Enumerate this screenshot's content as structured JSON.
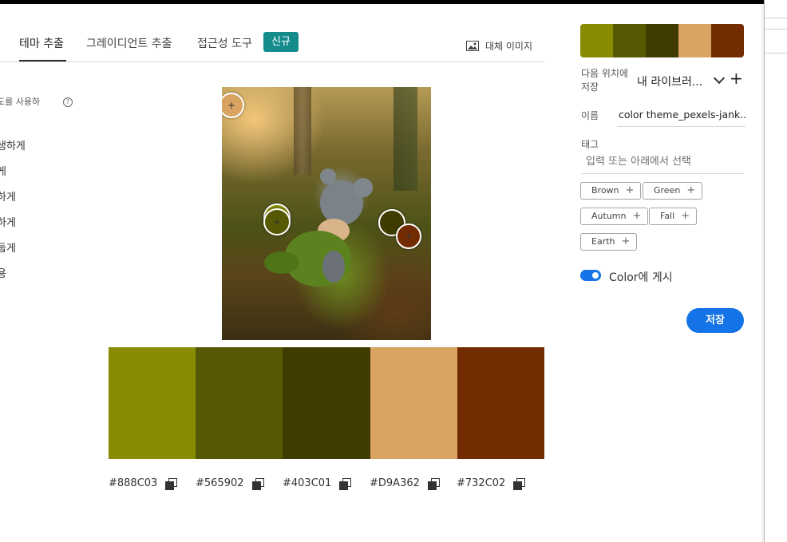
{
  "tabs": {
    "extract_theme": "테마 추출",
    "extract_gradient": "그레이디언트 추출",
    "accessibility": "접근성 도구",
    "badge_new": "신규",
    "alt_image": "대체 이미지"
  },
  "left_panel": {
    "hint": "도를 사용하",
    "info": "?",
    "moods": [
      "생하게",
      "게",
      "하게",
      "하게",
      "둡게",
      "용"
    ]
  },
  "swatches": [
    {
      "hex": "#888C03",
      "color": "#888C03"
    },
    {
      "hex": "#565902",
      "color": "#565902"
    },
    {
      "hex": "#403C01",
      "color": "#403C01"
    },
    {
      "hex": "#D9A362",
      "color": "#D9A362"
    },
    {
      "hex": "#732C02",
      "color": "#732C02"
    }
  ],
  "picker_colors": [
    "#D9A362",
    "#888C03",
    "#565902",
    "#403C01",
    "#732C02"
  ],
  "right_panel": {
    "theme_colors": [
      "#888C03",
      "#565902",
      "#403C01",
      "#D9A362",
      "#732C02"
    ],
    "save_location_label": "다음 위치에 저장",
    "library": "내 라이브러...",
    "add": "+",
    "name_label": "이름",
    "name_value": "color theme_pexels-jank...",
    "tag_label": "태그",
    "tag_placeholder": "입력 또는 아래에서 선택",
    "tags": [
      "Brown",
      "Green",
      "Autumn",
      "Fall",
      "Earth"
    ],
    "publish_label": "Color에 게시",
    "publish_on": true,
    "save_button": "저장"
  }
}
